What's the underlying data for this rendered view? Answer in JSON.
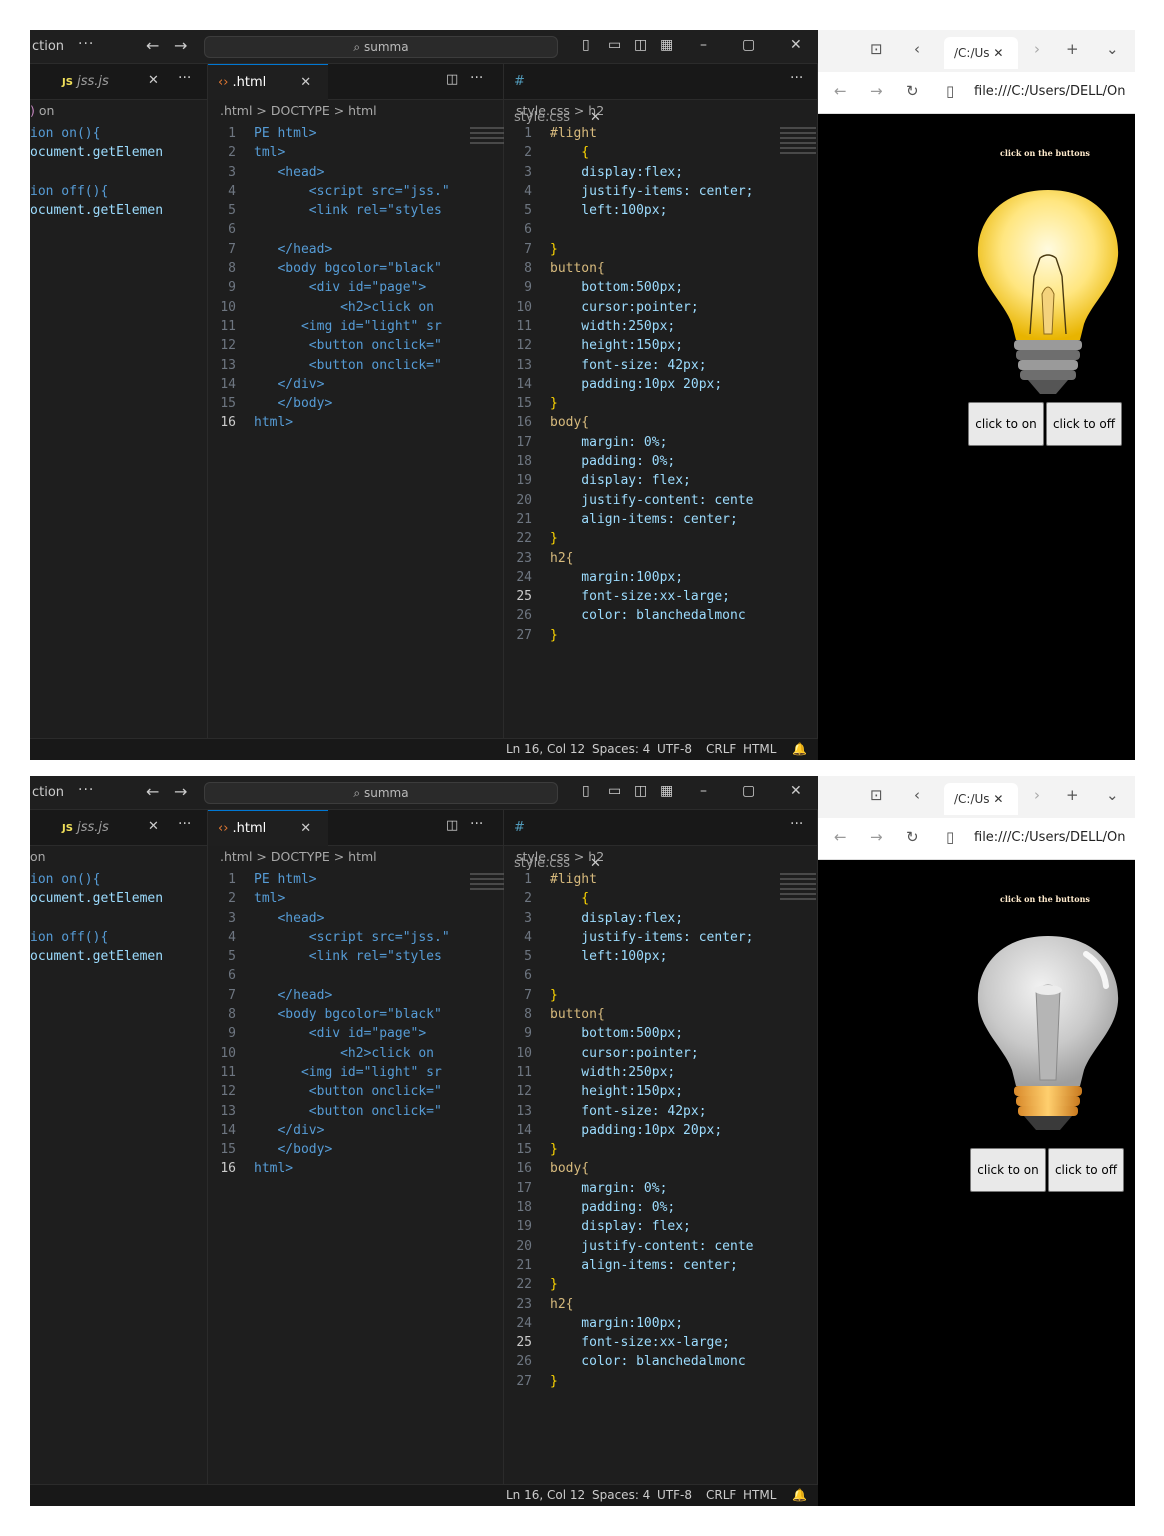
{
  "vscode": {
    "app_label": "ction",
    "search": "summa",
    "tabs": {
      "js": "jss.js",
      "html": ".html",
      "css": "style.css"
    },
    "js_breadcrumb": "on",
    "js_lines": [
      "ion on(){",
      "ocument.getElemen",
      "",
      "ion off(){",
      "ocument.getElemen"
    ],
    "html_breadcrumb": ".html > DOCTYPE > html",
    "css_breadcrumb": "style.css > h2",
    "html_lines": [
      [
        "1",
        "PE html>"
      ],
      [
        "2",
        "tml>"
      ],
      [
        "3",
        "   <head>"
      ],
      [
        "4",
        "       <script src=\"jss.\""
      ],
      [
        "5",
        "       <link rel=\"styles"
      ],
      [
        "6",
        ""
      ],
      [
        "7",
        "   </head>"
      ],
      [
        "8",
        "   <body bgcolor=\"black\""
      ],
      [
        "9",
        "       <div id=\"page\">"
      ],
      [
        "10",
        "           <h2>click on "
      ],
      [
        "11",
        "      <img id=\"light\" sr"
      ],
      [
        "12",
        "       <button onclick=\""
      ],
      [
        "13",
        "       <button onclick=\""
      ],
      [
        "14",
        "   </div>"
      ],
      [
        "15",
        "   </body>"
      ],
      [
        "16",
        "html>"
      ]
    ],
    "css_lines": [
      [
        "1",
        "#light"
      ],
      [
        "2",
        "    {"
      ],
      [
        "3",
        "    display:flex;"
      ],
      [
        "4",
        "    justify-items: center;"
      ],
      [
        "5",
        "    left:100px;"
      ],
      [
        "6",
        ""
      ],
      [
        "7",
        "}"
      ],
      [
        "8",
        "button{"
      ],
      [
        "9",
        "    bottom:500px;"
      ],
      [
        "10",
        "    cursor:pointer;"
      ],
      [
        "11",
        "    width:250px;"
      ],
      [
        "12",
        "    height:150px;"
      ],
      [
        "13",
        "    font-size: 42px;"
      ],
      [
        "14",
        "    padding:10px 20px;"
      ],
      [
        "15",
        "}"
      ],
      [
        "16",
        "body{"
      ],
      [
        "17",
        "    margin: 0%;"
      ],
      [
        "18",
        "    padding: 0%;"
      ],
      [
        "19",
        "    display: flex;"
      ],
      [
        "20",
        "    justify-content: cente"
      ],
      [
        "21",
        "    align-items: center;"
      ],
      [
        "22",
        "}"
      ],
      [
        "23",
        "h2{"
      ],
      [
        "24",
        "    margin:100px;"
      ],
      [
        "25",
        "    font-size:xx-large;"
      ],
      [
        "26",
        "    color: blanchedalmonc"
      ],
      [
        "27",
        "}"
      ]
    ],
    "status": {
      "pos": "Ln 16, Col 12",
      "spaces": "Spaces: 4",
      "enc": "UTF-8",
      "eol": "CRLF",
      "lang": "HTML"
    }
  },
  "browser": {
    "tab_title": "/C:/Us",
    "url": "file:///C:/Users/DELL/On",
    "heading": "click on the buttons",
    "btn_on": "click to on",
    "btn_off": "click to off"
  }
}
